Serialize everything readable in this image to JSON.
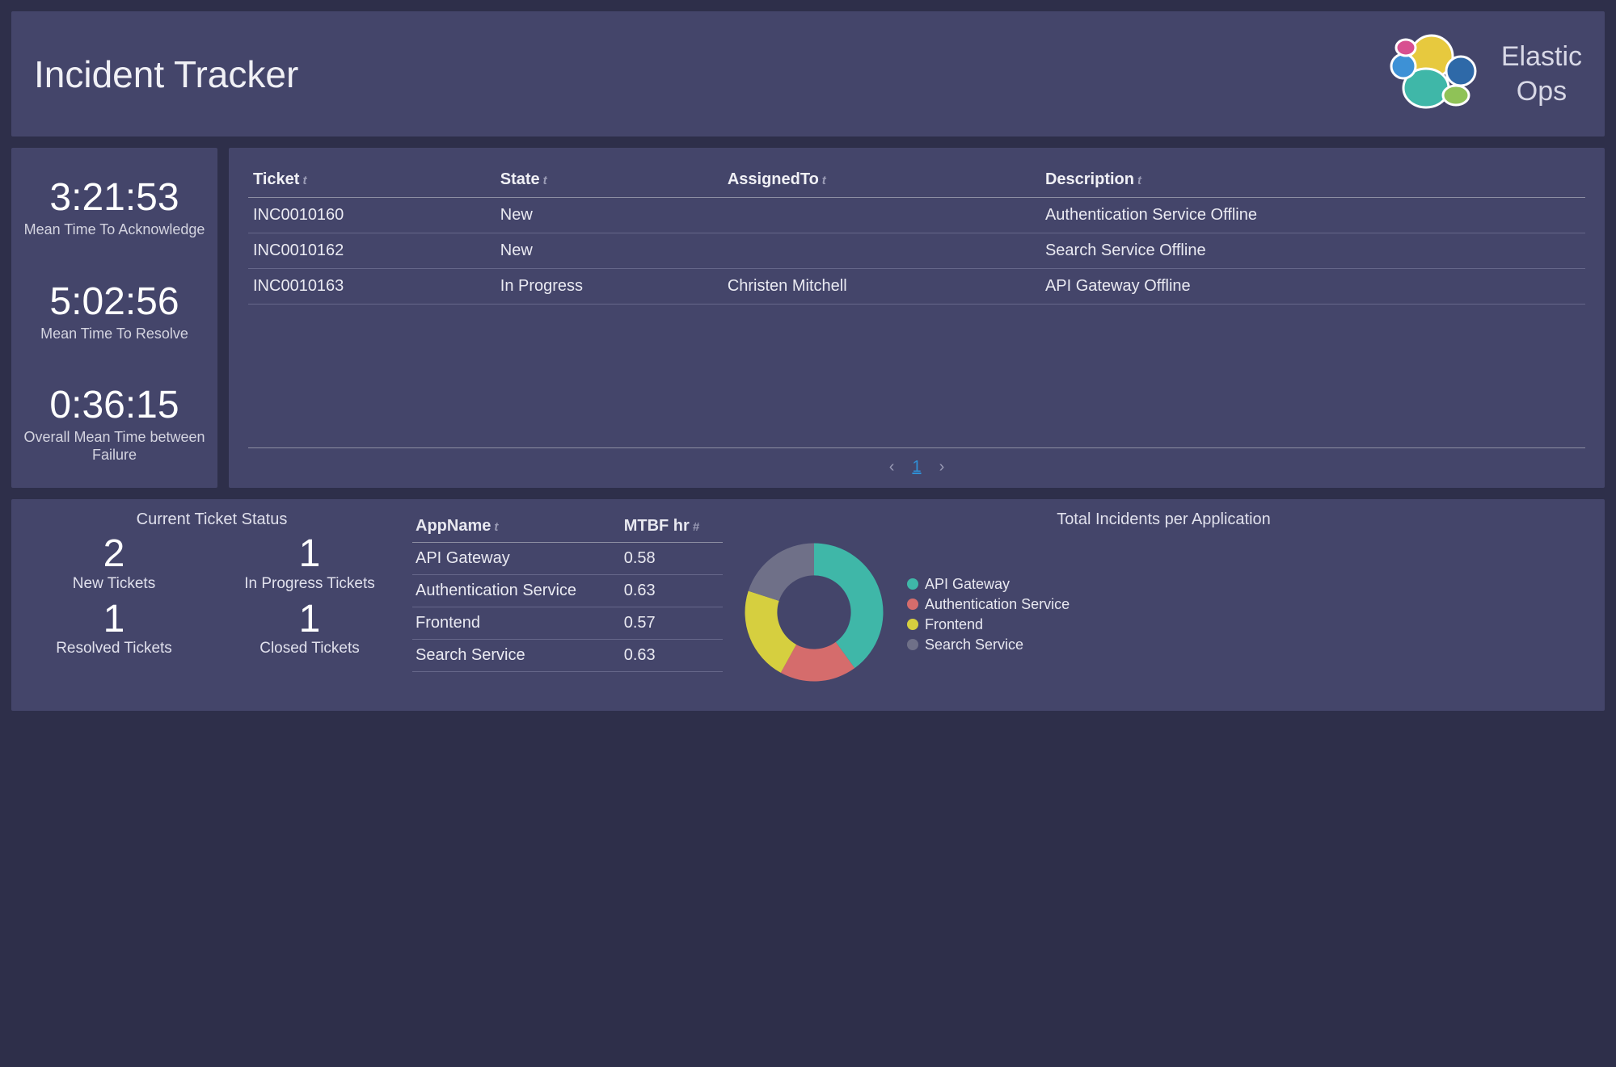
{
  "header": {
    "title": "Incident Tracker",
    "brand_line1": "Elastic",
    "brand_line2": "Ops"
  },
  "metrics": [
    {
      "value": "3:21:53",
      "label": "Mean Time To Acknowledge"
    },
    {
      "value": "5:02:56",
      "label": "Mean Time To Resolve"
    },
    {
      "value": "0:36:15",
      "label": "Overall Mean Time between Failure"
    }
  ],
  "tickets_table": {
    "columns": [
      "Ticket",
      "State",
      "AssignedTo",
      "Description"
    ],
    "rows": [
      {
        "ticket": "INC0010160",
        "state": "New",
        "assigned": "",
        "description": "Authentication Service Offline"
      },
      {
        "ticket": "INC0010162",
        "state": "New",
        "assigned": "",
        "description": "Search Service Offline"
      },
      {
        "ticket": "INC0010163",
        "state": "In Progress",
        "assigned": "Christen Mitchell",
        "description": "API Gateway Offline"
      }
    ],
    "page": "1"
  },
  "status": {
    "title": "Current Ticket Status",
    "items": [
      {
        "count": "2",
        "label": "New Tickets"
      },
      {
        "count": "1",
        "label": "In Progress Tickets"
      },
      {
        "count": "1",
        "label": "Resolved Tickets"
      },
      {
        "count": "1",
        "label": "Closed Tickets"
      }
    ]
  },
  "mtbf_table": {
    "columns": [
      "AppName",
      "MTBF hr"
    ],
    "rows": [
      {
        "app": "API Gateway",
        "mtbf": "0.58"
      },
      {
        "app": "Authentication Service",
        "mtbf": "0.63"
      },
      {
        "app": "Frontend",
        "mtbf": "0.57"
      },
      {
        "app": "Search Service",
        "mtbf": "0.63"
      }
    ]
  },
  "donut": {
    "title": "Total Incidents per Application",
    "legend": [
      {
        "label": "API Gateway",
        "color": "#3fb7a8"
      },
      {
        "label": "Authentication Service",
        "color": "#d56c6c"
      },
      {
        "label": "Frontend",
        "color": "#d6cf3f"
      },
      {
        "label": "Search Service",
        "color": "#6f7088"
      }
    ]
  },
  "chart_data": {
    "type": "pie",
    "title": "Total Incidents per Application",
    "series": [
      {
        "name": "API Gateway",
        "value": 40,
        "color": "#3fb7a8"
      },
      {
        "name": "Authentication Service",
        "value": 18,
        "color": "#d56c6c"
      },
      {
        "name": "Frontend",
        "value": 22,
        "color": "#d6cf3f"
      },
      {
        "name": "Search Service",
        "value": 20,
        "color": "#6f7088"
      }
    ]
  }
}
